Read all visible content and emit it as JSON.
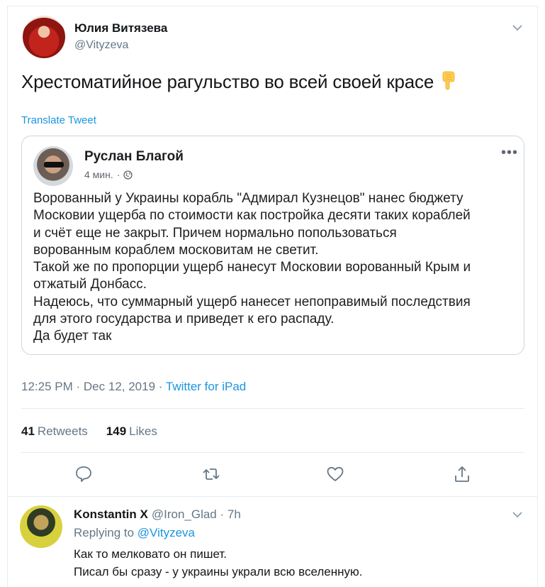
{
  "tweet": {
    "author_name": "Юлия Витязева",
    "author_handle": "@Vityzeva",
    "text": "Хрестоматийное рагульство во всей своей красе",
    "emoji_icon": "pointing-down-hand-icon",
    "translate_label": "Translate Tweet",
    "time": "12:25 PM",
    "date": "Dec 12, 2019",
    "source": "Twitter for iPad",
    "retweets_count": "41",
    "retweets_label": "Retweets",
    "likes_count": "149",
    "likes_label": "Likes",
    "actions": [
      "reply-icon",
      "retweet-icon",
      "like-icon",
      "share-icon"
    ]
  },
  "quoted_post": {
    "name": "Руслан Благой",
    "time": "4 мин.",
    "separator": "·",
    "privacy_icon": "globe-icon",
    "more": "•••",
    "lines": [
      "Ворованный у Украины корабль \"Адмирал Кузнецов\"  нанес бюджету",
      "Московии ущерба по стоимости как постройка десяти таких кораблей",
      "и счёт еще не закрыт. Причем нормально попользоваться",
      "ворованным кораблем московитам не светит.",
      "Такой же по пропорции ущерб нанесут Московии ворованный Крым и",
      "отжатый Донбасс.",
      "Надеюсь, что суммарный ущерб нанесет непоправимый последствия",
      "для этого государства и приведет к его распаду.",
      "Да будет так"
    ]
  },
  "reply": {
    "author_name": "Konstantin X",
    "author_handle": "@Iron_Glad",
    "separator": "·",
    "time": "7h",
    "replying_label": "Replying to",
    "replying_to": "@Vityzeva",
    "lines": [
      "Как то мелковато он пишет.",
      "Писал бы сразу - у украины украли всю вселенную."
    ]
  },
  "colors": {
    "accent": "#1b95e0",
    "muted": "#657786",
    "text": "#14171a",
    "border": "#e6ecf0"
  }
}
